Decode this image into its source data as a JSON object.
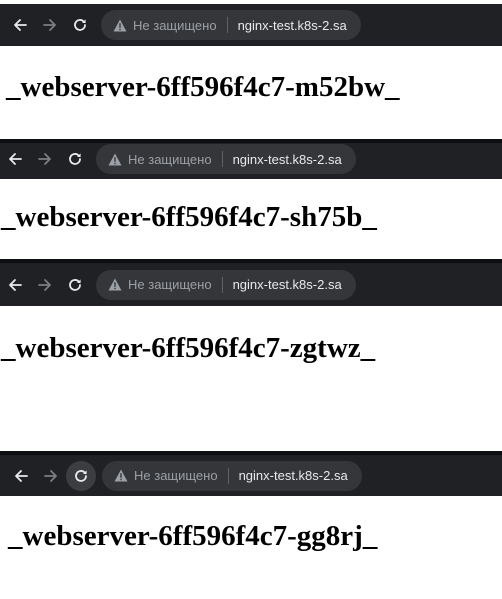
{
  "browser": {
    "security_label": "Не защищено",
    "url": "nginx-test.k8s-2.sa",
    "icons": {
      "back": "back-arrow-icon",
      "forward": "forward-arrow-icon",
      "reload": "reload-icon",
      "warning": "warning-triangle-icon"
    },
    "colors": {
      "toolbar": "#202124",
      "omnibox": "#35363a",
      "text_muted": "#9aa0a6",
      "text_url": "#e8eaed"
    }
  },
  "snippets": [
    {
      "hostname": "_webserver-6ff596f4c7-m52bw_"
    },
    {
      "hostname": "_webserver-6ff596f4c7-sh75b_"
    },
    {
      "hostname": "_webserver-6ff596f4c7-zgtwz_"
    },
    {
      "hostname": "_webserver-6ff596f4c7-gg8rj_"
    }
  ]
}
